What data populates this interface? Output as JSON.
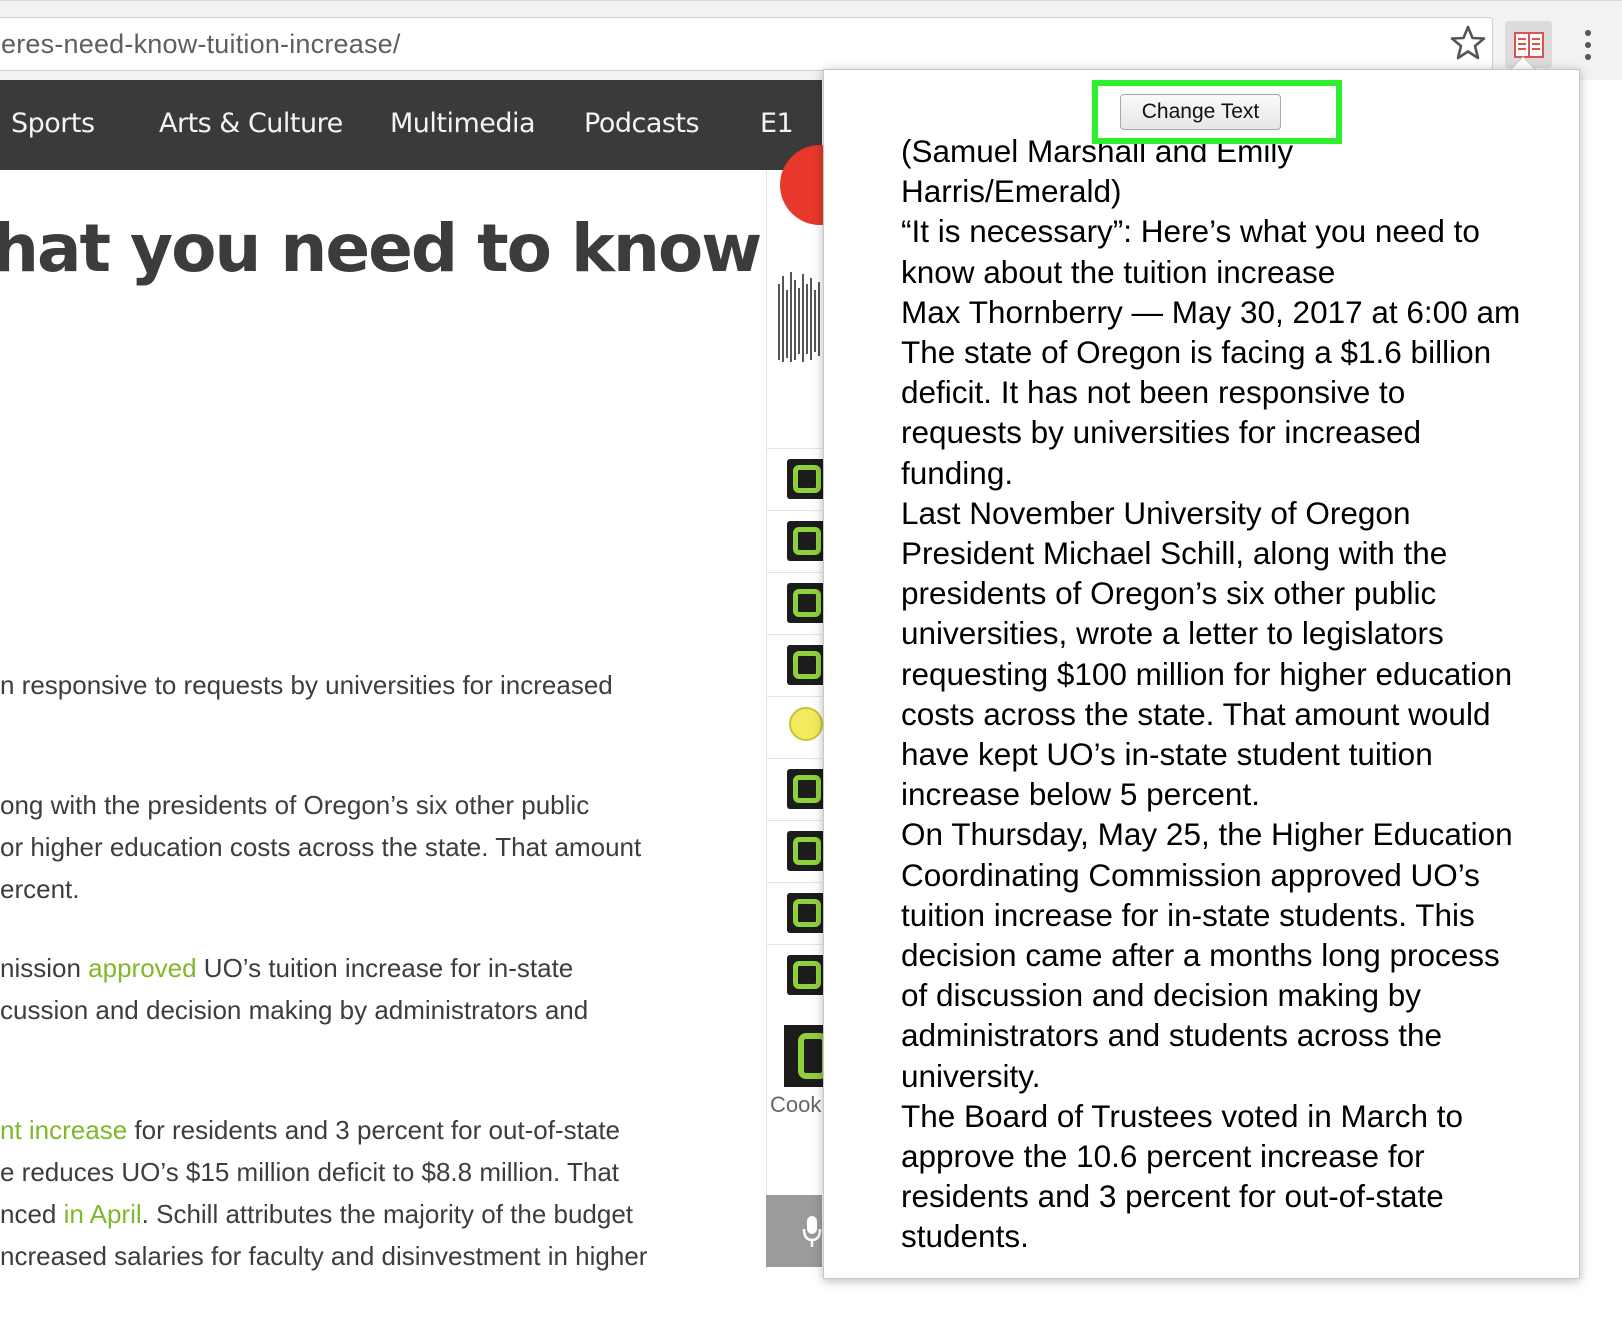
{
  "browser": {
    "url": "eres-need-know-tuition-increase/",
    "bookmark_icon": "star-icon",
    "extension_icon": "reader-extension-icon",
    "menu_icon": "kebab-menu-icon"
  },
  "site_nav": {
    "items": [
      "Sports",
      "Arts & Culture",
      "Multimedia",
      "Podcasts",
      "E1"
    ]
  },
  "article": {
    "headline_fragment": "hat you need to know",
    "lines": [
      {
        "before": "n responsive to requests by universities for increased",
        "link": "",
        "after": ""
      },
      {
        "before": "ong with the presidents of Oregon’s six other public",
        "link": "",
        "after": ""
      },
      {
        "before": "or higher education costs across the state. That amount",
        "link": "",
        "after": ""
      },
      {
        "before": "ercent.",
        "link": "",
        "after": ""
      },
      {
        "before": "nission ",
        "link": "approved",
        "after": " UO’s tuition increase for in-state"
      },
      {
        "before": "cussion and decision making by administrators and",
        "link": "",
        "after": ""
      },
      {
        "before": "",
        "link": "nt increase",
        "after": " for residents and 3 percent for out-of-state"
      },
      {
        "before": "e reduces UO’s $15 million deficit to $8.8 million. That",
        "link": "",
        "after": ""
      },
      {
        "before": "nced ",
        "link": "in April",
        "after": ". Schill attributes the majority of the budget"
      },
      {
        "before": "ncreased salaries for faculty and disinvestment in higher",
        "link": "",
        "after": ""
      }
    ],
    "link_color": "#7fb82a"
  },
  "sidebar": {
    "cookie_text": "Cook"
  },
  "popup": {
    "button_label": "Change Text",
    "highlight_color": "#2ef02e",
    "paragraphs": [
      "(Samuel Marshall and Emily Harris/Emerald)",
      "“It is necessary”: Here’s what you need to know about the tuition increase",
      "Max Thornberry — May 30, 2017 at 6:00 am",
      "The state of Oregon is facing a $1.6 billion deficit. It has not been responsive to requests by universities for increased funding.",
      "Last November University of Oregon President Michael Schill, along with the presidents of Oregon’s six other public universities, wrote a letter to legislators requesting $100 million for higher education costs across the state. That amount would have kept UO’s in-state student tuition increase below 5 percent.",
      "On Thursday, May 25, the Higher Education Coordinating Commission approved UO’s tuition increase for in-state students. This decision came after a months long process of discussion and decision making by administrators and students across the university.",
      "The Board of Trustees voted in March to approve the 10.6 percent increase for residents and 3 percent for out-of-state students."
    ]
  }
}
